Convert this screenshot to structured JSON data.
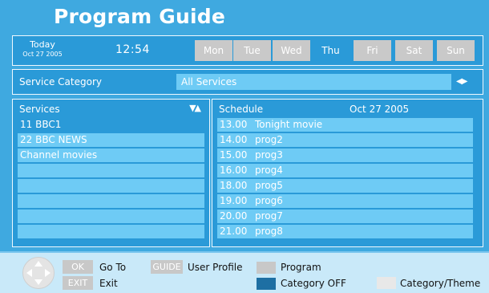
{
  "title": "Program Guide",
  "header": {
    "today_label": "Today",
    "today_date": "Oct 27 2005",
    "clock": "12:54",
    "days": [
      "Mon",
      "Tue",
      "Wed",
      "Thu",
      "Fri",
      "Sat",
      "Sun"
    ],
    "selected_day": "Thu"
  },
  "category": {
    "label": "Service Category",
    "value": "All Services"
  },
  "services": {
    "header": "Services",
    "items": [
      "11 BBC1",
      "22 BBC NEWS",
      "Channel movies",
      "",
      "",
      "",
      "",
      ""
    ],
    "selected_index": 0
  },
  "schedule": {
    "header": "Schedule",
    "date": "Oct 27  2005",
    "items": [
      {
        "time": "13.00",
        "name": "Tonight movie"
      },
      {
        "time": "14.00",
        "name": "prog2"
      },
      {
        "time": "15.00",
        "name": "prog3"
      },
      {
        "time": "16.00",
        "name": "prog4"
      },
      {
        "time": "18.00",
        "name": "prog5"
      },
      {
        "time": "19.00",
        "name": "prog6"
      },
      {
        "time": "20.00",
        "name": "prog7"
      },
      {
        "time": "21.00",
        "name": "prog8"
      }
    ]
  },
  "footer": {
    "ok_key": "OK",
    "ok_action": "Go To",
    "exit_key": "EXIT",
    "exit_action": "Exit",
    "guide_key": "GUIDE",
    "guide_action": "User Profile",
    "legend_program": "Program",
    "legend_category_off": "Category OFF",
    "legend_category_theme": "Category/Theme"
  },
  "colors": {
    "background": "#3fa9e0",
    "row": "#6ecbf5",
    "selected": "#2a9ad8",
    "key_grey": "#c8c8c8",
    "footer_bg": "#c9e9f9",
    "category_off_swatch": "#1e6fa3"
  }
}
